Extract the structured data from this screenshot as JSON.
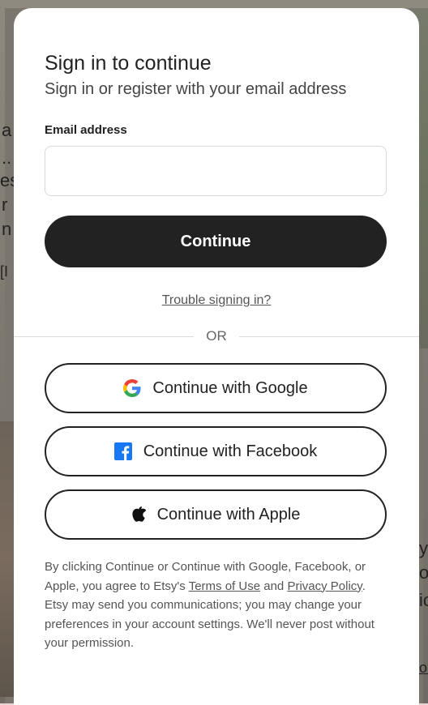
{
  "background": {
    "fragments": [
      "a",
      "..",
      "es",
      "r",
      "n",
      "[I",
      "y",
      "o",
      "ic",
      "or"
    ]
  },
  "modal": {
    "title": "Sign in to continue",
    "subtitle": "Sign in or register with your email address",
    "email": {
      "label": "Email address",
      "value": "",
      "placeholder": ""
    },
    "continue_label": "Continue",
    "trouble_label": "Trouble signing in?",
    "divider_label": "OR",
    "social": {
      "google_label": "Continue with Google",
      "facebook_label": "Continue with Facebook",
      "apple_label": "Continue with Apple"
    },
    "legal": {
      "part1": "By clicking Continue or Continue with Google, Facebook, or Apple, you agree to Etsy's ",
      "terms_link": "Terms of Use",
      "part2": " and ",
      "privacy_link": "Privacy Policy",
      "part3": ". Etsy may send you communications; you may change your preferences in your account settings. We'll never post without your permission."
    }
  },
  "colors": {
    "primary_button": "#222222",
    "google_blue": "#4285F4",
    "google_red": "#EA4335",
    "google_yellow": "#FBBC05",
    "google_green": "#34A853",
    "facebook_blue": "#1877F2"
  },
  "icons": {
    "google": "google-g-icon",
    "facebook": "facebook-f-icon",
    "apple": "apple-logo-icon"
  }
}
